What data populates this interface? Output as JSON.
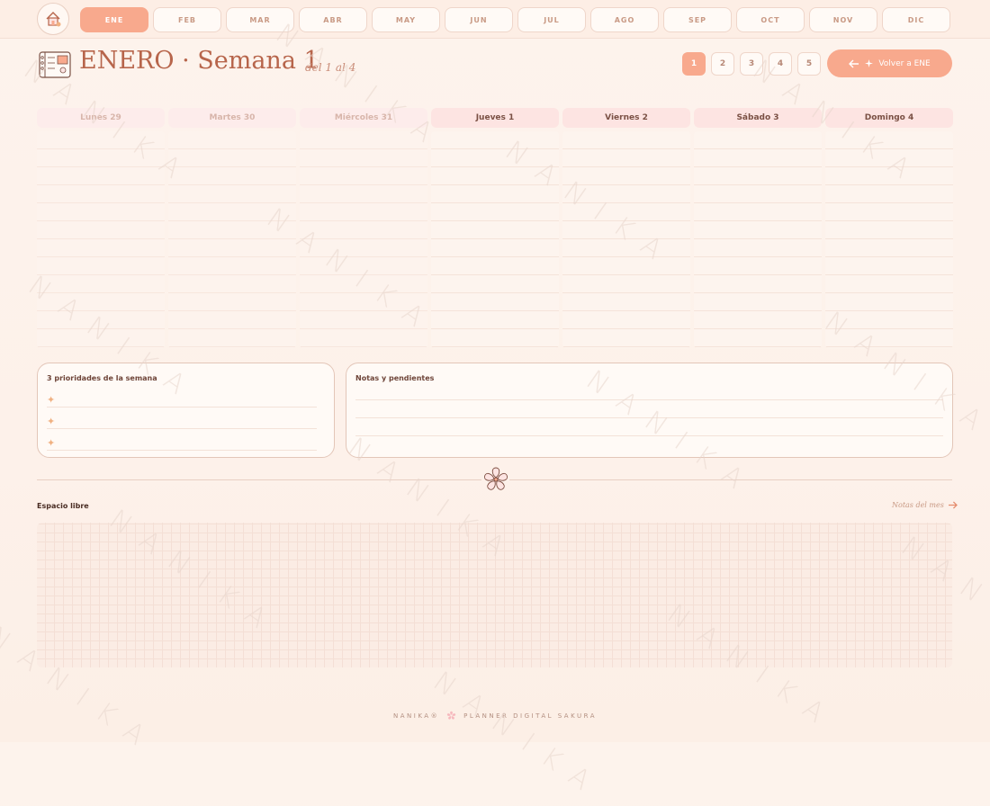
{
  "nav": {
    "months": [
      "ENE",
      "FEB",
      "MAR",
      "ABR",
      "MAY",
      "JUN",
      "JUL",
      "AGO",
      "SEP",
      "OCT",
      "NOV",
      "DIC"
    ],
    "active_month": "ENE",
    "home_icon": "house-icon"
  },
  "header": {
    "title": "ENERO · Semana 1",
    "subtitle": "del 1 al 4",
    "weeks": [
      "1",
      "2",
      "3",
      "4",
      "5"
    ],
    "active_week": "1",
    "back_label": "Volver a ENE"
  },
  "days": [
    {
      "label": "Lunes 29",
      "faded": true
    },
    {
      "label": "Martes 30",
      "faded": true
    },
    {
      "label": "Miércoles 31",
      "faded": true
    },
    {
      "label": "Jueves 1",
      "faded": false
    },
    {
      "label": "Viernes 2",
      "faded": false
    },
    {
      "label": "Sábado 3",
      "faded": false
    },
    {
      "label": "Domingo 4",
      "faded": false
    }
  ],
  "priorities": {
    "title": "3 prioridades de la semana"
  },
  "notes": {
    "title": "Notas y pendientes"
  },
  "free_space": {
    "label": "Espacio libre",
    "link": "Notas del mes"
  },
  "footer": {
    "brand": "NANIKA®",
    "text": "PLANNER DIGITAL SAKURA"
  },
  "watermark": "NANIKA",
  "colors": {
    "accent": "#f8a98d",
    "title": "#b7654b",
    "day_header": "#fde4e2",
    "background": "#fdf3ec"
  }
}
